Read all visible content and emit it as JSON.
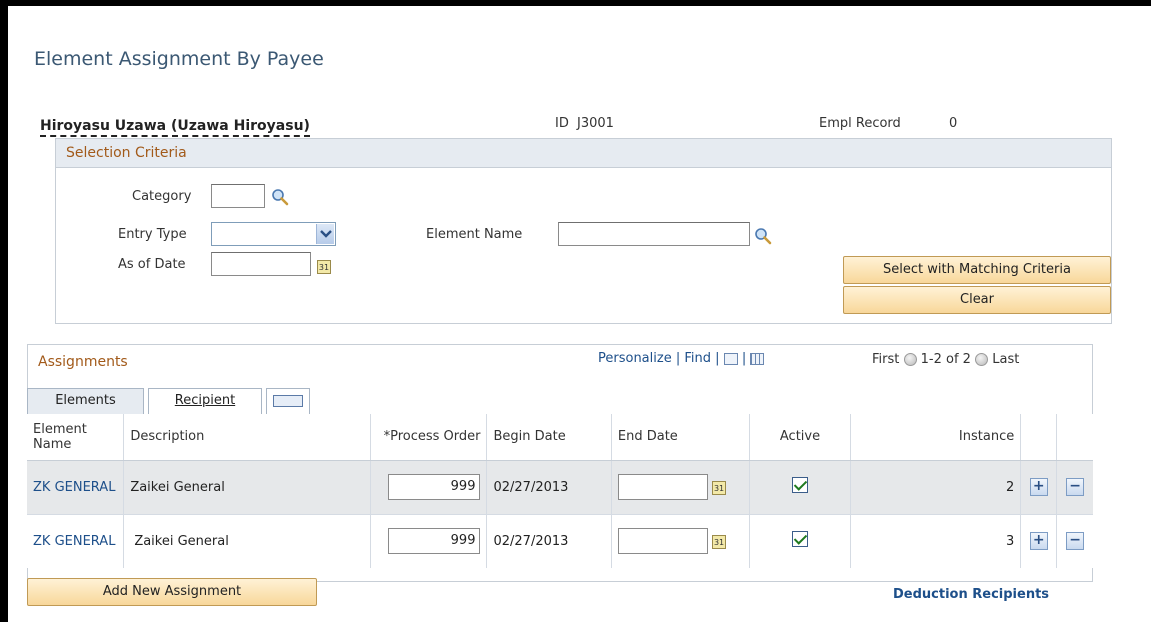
{
  "page": {
    "title": "Element Assignment By Payee"
  },
  "payee": {
    "name": "Hiroyasu Uzawa (Uzawa Hiroyasu)",
    "id_label": "ID",
    "id_value": "J3001",
    "empl_record_label": "Empl Record",
    "empl_record_value": "0"
  },
  "selection": {
    "header": "Selection Criteria",
    "category_label": "Category",
    "category_value": "",
    "entry_type_label": "Entry Type",
    "entry_type_value": "",
    "element_name_label": "Element Name",
    "element_name_value": "",
    "as_of_date_label": "As of Date",
    "as_of_date_value": "",
    "select_button": "Select with Matching Criteria",
    "clear_button": "Clear"
  },
  "assignments": {
    "header": "Assignments",
    "personalize": "Personalize",
    "find": "Find",
    "first": "First",
    "range": "1-2 of 2",
    "last": "Last",
    "tabs": [
      "Elements",
      "Recipient"
    ],
    "columns": {
      "element_name": "Element Name",
      "description": "Description",
      "process_order": "*Process Order",
      "begin_date": "Begin Date",
      "end_date": "End Date",
      "active": "Active",
      "instance": "Instance"
    },
    "rows": [
      {
        "element_name": "ZK GENERAL",
        "description": "Zaikei General",
        "process_order": "999",
        "begin_date": "02/27/2013",
        "end_date": "",
        "active": true,
        "instance": "2"
      },
      {
        "element_name": "ZK GENERAL",
        "description": "Zaikei General",
        "process_order": "999",
        "begin_date": "02/27/2013",
        "end_date": "",
        "active": true,
        "instance": "3"
      }
    ]
  },
  "footer": {
    "add_button": "Add New Assignment",
    "deduction_link": "Deduction Recipients"
  },
  "icons": {
    "lookup": "magnifier-icon",
    "calendar": "calendar-icon",
    "add_row": "plus-icon",
    "delete_row": "minus-icon"
  }
}
